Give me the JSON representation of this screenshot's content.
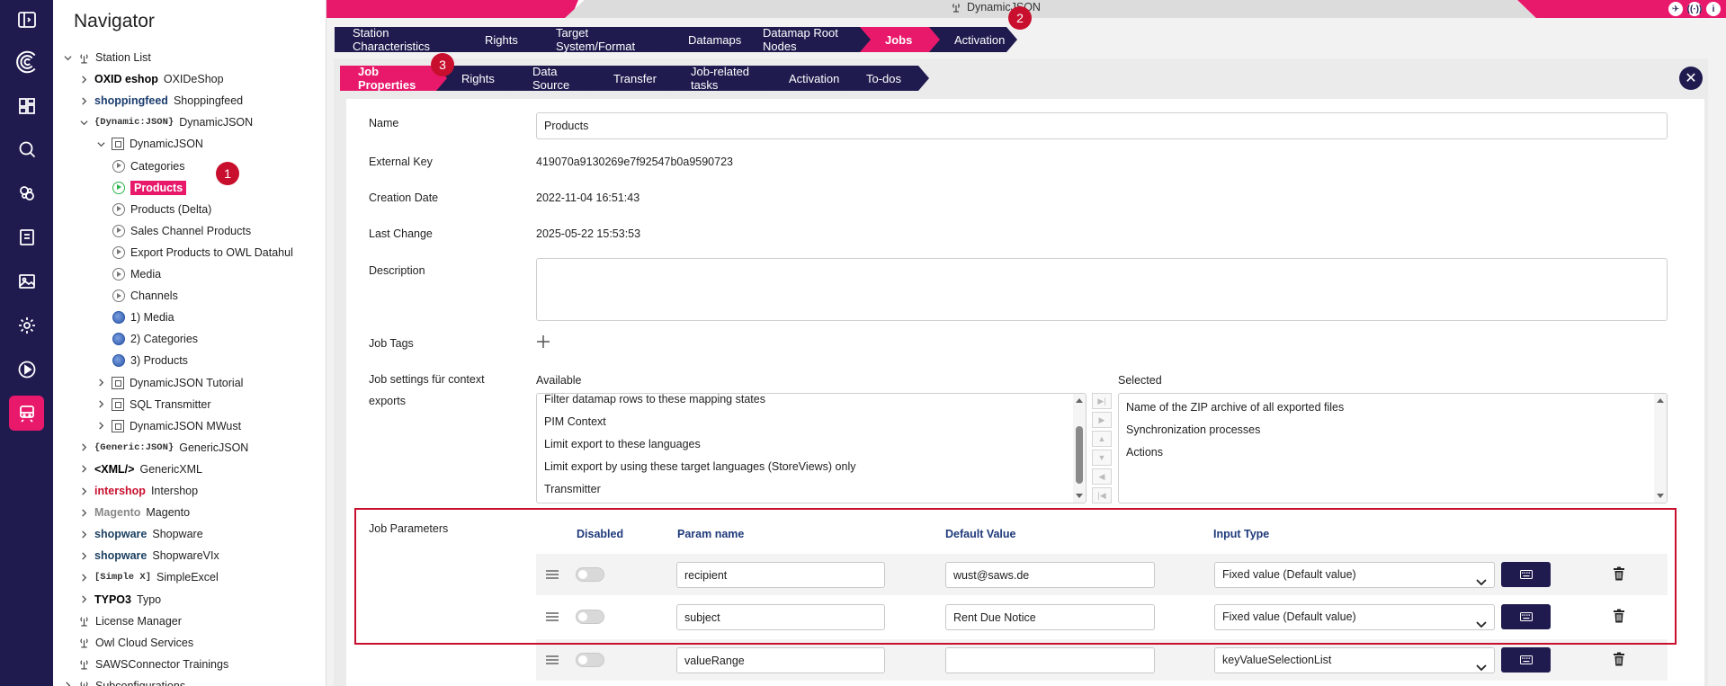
{
  "rail": {
    "items": [
      {
        "name": "panel-toggle-icon"
      },
      {
        "name": "logo-icon"
      },
      {
        "name": "dashboard-icon"
      },
      {
        "name": "search-icon"
      },
      {
        "name": "connections-icon"
      },
      {
        "name": "catalog-icon"
      },
      {
        "name": "image-icon"
      },
      {
        "name": "settings-icon"
      },
      {
        "name": "play-icon"
      },
      {
        "name": "station-icon"
      }
    ],
    "active_color": "#e8196b",
    "bg_color": "#1f1b4f"
  },
  "navigator": {
    "title": "Navigator",
    "tree": [
      {
        "label": "Station List",
        "chev": "down",
        "icon": "station-icon"
      },
      {
        "label": "OXIDeShop",
        "brand": "OXID eshop",
        "chev": "right"
      },
      {
        "label": "Shoppingfeed",
        "brand": "shoppingfeed",
        "chev": "right"
      },
      {
        "label": "DynamicJSON",
        "brand": "{Dynamic:JSON}",
        "chev": "down"
      },
      {
        "label": "DynamicJSON",
        "chev": "down",
        "icon": "building-icon"
      },
      {
        "label": "Categories",
        "icon": "play-icon"
      },
      {
        "label": "Products",
        "icon": "play-icon-green",
        "selected": true
      },
      {
        "label": "Products (Delta)",
        "icon": "play-icon"
      },
      {
        "label": "Sales Channel Products",
        "icon": "play-icon"
      },
      {
        "label": "Export Products to OWL Datahul",
        "icon": "play-icon"
      },
      {
        "label": "Media",
        "icon": "play-icon"
      },
      {
        "label": "Channels",
        "icon": "play-icon"
      },
      {
        "label": "1) Media",
        "icon": "globe-icon"
      },
      {
        "label": "2) Categories",
        "icon": "globe-icon"
      },
      {
        "label": "3) Products",
        "icon": "globe-icon"
      },
      {
        "label": "DynamicJSON Tutorial",
        "chev": "right",
        "icon": "building-icon"
      },
      {
        "label": "SQL Transmitter",
        "chev": "right",
        "icon": "building-icon"
      },
      {
        "label": "DynamicJSON MWust",
        "chev": "right",
        "icon": "building-icon"
      },
      {
        "label": "GenericJSON",
        "brand": "{Generic:JSON}",
        "chev": "right"
      },
      {
        "label": "GenericXML",
        "brand": "<XML/>",
        "chev": "right"
      },
      {
        "label": "Intershop",
        "brand": "intershop",
        "chev": "right"
      },
      {
        "label": "Magento",
        "brand": "Magento",
        "chev": "right"
      },
      {
        "label": "Shopware",
        "brand": "shopware",
        "chev": "right"
      },
      {
        "label": "ShopwareVIx",
        "brand": "shopware",
        "chev": "right"
      },
      {
        "label": "SimpleExcel",
        "brand": "[Simple X]",
        "chev": "right"
      },
      {
        "label": "Typo",
        "brand": "TYPO3",
        "chev": "right"
      },
      {
        "label": "License Manager",
        "icon": "license-icon"
      },
      {
        "label": "Owl Cloud Services",
        "icon": "owl-icon"
      },
      {
        "label": "SAWSConnector Trainings",
        "icon": "station-icon"
      },
      {
        "label": "Subconfigurations",
        "chev": "right",
        "icon": "link-icon"
      }
    ]
  },
  "topbar": {
    "station_title": "DynamicJSON",
    "icons": [
      "plane-icon",
      "antenna-icon",
      "info-icon"
    ]
  },
  "main_tabs": [
    {
      "label": "Station Characteristics"
    },
    {
      "label": "Rights"
    },
    {
      "label": "Target System/Format"
    },
    {
      "label": "Datamaps"
    },
    {
      "label": "Datamap Root Nodes"
    },
    {
      "label": "Jobs",
      "active": true
    },
    {
      "label": "Activation"
    }
  ],
  "job_tabs": [
    {
      "label": "Job Properties",
      "active": true
    },
    {
      "label": "Rights"
    },
    {
      "label": "Data Source"
    },
    {
      "label": "Transfer"
    },
    {
      "label": "Job-related tasks"
    },
    {
      "label": "Activation"
    },
    {
      "label": "To-dos"
    }
  ],
  "badges": {
    "one": "1",
    "two": "2",
    "three": "3"
  },
  "form": {
    "name_label": "Name",
    "name_value": "Products",
    "external_key_label": "External Key",
    "external_key_value": "419070a9130269e7f92547b0a9590723",
    "creation_date_label": "Creation Date",
    "creation_date_value": "2022-11-04 16:51:43",
    "last_change_label": "Last Change",
    "last_change_value": "2025-05-22 15:53:53",
    "description_label": "Description",
    "description_value": "",
    "job_tags_label": "Job Tags",
    "context_label_line1": "Job settings für context",
    "context_label_line2": "exports",
    "available_label": "Available",
    "selected_label": "Selected",
    "available_items": [
      "Filter datamap rows to these mapping states",
      "PIM Context",
      "Limit export to these languages",
      "Limit export by using these target languages (StoreViews) only",
      "Transmitter"
    ],
    "selected_items": [
      "Name of the ZIP archive of all exported files",
      "Synchronization processes",
      "Actions"
    ],
    "job_parameters_label": "Job Parameters"
  },
  "params": {
    "headers": {
      "disabled": "Disabled",
      "param_name": "Param name",
      "default_value": "Default Value",
      "input_type": "Input Type"
    },
    "rows": [
      {
        "param_name": "recipient",
        "default_value": "wust@saws.de",
        "input_type": "Fixed value (Default value)"
      },
      {
        "param_name": "subject",
        "default_value": "Rent Due Notice",
        "input_type": "Fixed value (Default value)"
      },
      {
        "param_name": "valueRange",
        "default_value": "",
        "input_type": "keyValueSelectionList"
      }
    ]
  },
  "colors": {
    "accent": "#e8196b",
    "navy": "#1f1b4f",
    "highlight": "#c8102e",
    "header_blue": "#1f3a7a"
  }
}
